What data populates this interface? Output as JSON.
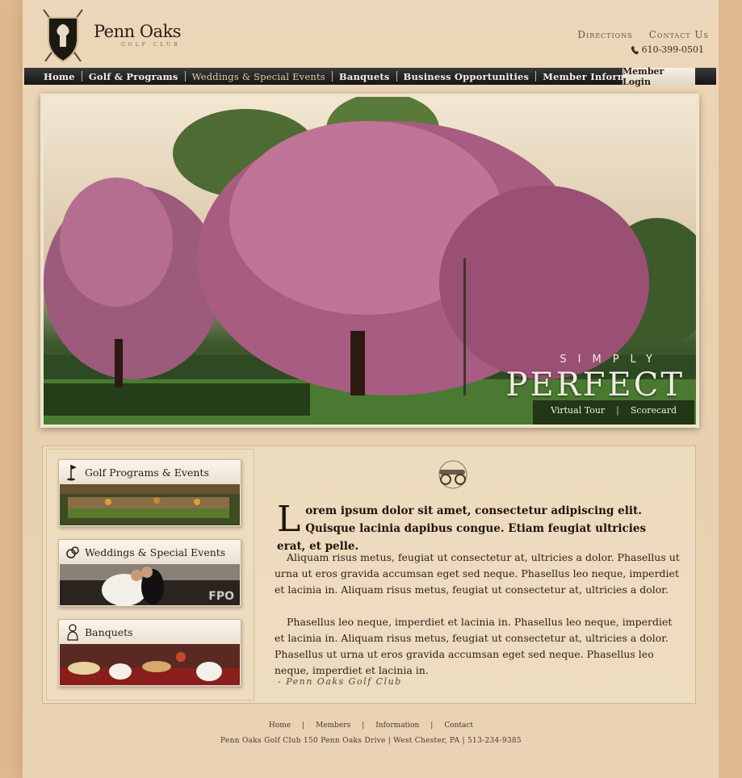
{
  "brand": {
    "name": "Penn Oaks",
    "subtitle": "GOLF CLUB"
  },
  "header": {
    "links": [
      "Directions",
      "Contact Us"
    ],
    "phone": "610-399-0501"
  },
  "nav": {
    "items": [
      "Home",
      "Golf & Programs",
      "Weddings & Special Events",
      "Banquets",
      "Business Opportunities",
      "Member Information"
    ],
    "active": "Weddings & Special Events",
    "member_login": "Member Login"
  },
  "hero": {
    "tagline_small": "SIMPLY",
    "tagline_big": "PERFECT",
    "links": [
      "Virtual Tour",
      "Scorecard"
    ],
    "separator": "|"
  },
  "sidebar": {
    "cards": [
      {
        "title": "Golf Programs & Events",
        "icon": "golf-flag-icon"
      },
      {
        "title": "Weddings & Special Events",
        "icon": "rings-icon",
        "badge": "FPO"
      },
      {
        "title": "Banquets",
        "icon": "chef-icon"
      }
    ]
  },
  "main": {
    "dropcap": "L",
    "lead": "orem ipsum dolor sit amet, consectetur adipiscing elit. Quisque lacinia dapibus congue. Etiam feugiat ultricies erat, et pelle.",
    "paragraphs": [
      "Aliquam risus metus, feugiat ut consectetur at, ultricies a dolor. Phasellus ut urna ut eros gravida accumsan eget sed neque. Phasellus leo neque, imperdiet et lacinia in. Aliquam risus metus, feugiat ut consectetur at, ultricies a dolor.",
      "Phasellus leo neque, imperdiet et lacinia in. Phasellus leo neque, imperdiet et lacinia in. Aliquam risus metus, feugiat ut consectetur at, ultricies a dolor. Phasellus ut urna ut eros gravida accumsan eget sed neque. Phasellus leo neque, imperdiet et lacinia in."
    ],
    "signature": "- Penn Oaks Golf Club"
  },
  "footer": {
    "links": [
      "Home",
      "Members",
      "Information",
      "Contact"
    ],
    "separator": "|",
    "address": "Penn Oaks Golf Club 150 Penn Oaks Drive | West Chester, PA | 513-234-9385"
  },
  "colors": {
    "nav_bg": "#1d1d1d",
    "accent": "#e8cda5",
    "page_bg": "#e9d3b4"
  }
}
